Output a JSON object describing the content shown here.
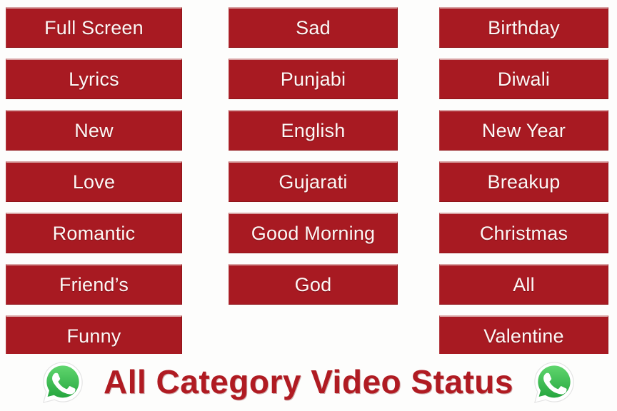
{
  "app": {
    "title": "All Category Video Status",
    "title_color": "#b01b22",
    "button_color": "#a81a22",
    "button_text_color": "#fdf7f5",
    "background_color": "#fdfdfc"
  },
  "footer": {
    "left_icon": "whatsapp-icon",
    "right_icon": "whatsapp-icon",
    "icon_color_light": "#5ed06a",
    "icon_color_dark": "#2aa84a"
  },
  "grid": {
    "columns": [
      {
        "name": "column-1",
        "buttons": [
          {
            "label": "Full Screen"
          },
          {
            "label": "Lyrics"
          },
          {
            "label": "New"
          },
          {
            "label": "Love"
          },
          {
            "label": "Romantic"
          },
          {
            "label": "Friend’s"
          },
          {
            "label": "Funny"
          }
        ]
      },
      {
        "name": "column-2",
        "buttons": [
          {
            "label": "Sad"
          },
          {
            "label": "Punjabi"
          },
          {
            "label": "English"
          },
          {
            "label": "Gujarati"
          },
          {
            "label": "Good Morning"
          },
          {
            "label": "God"
          },
          {
            "label": ""
          }
        ]
      },
      {
        "name": "column-3",
        "buttons": [
          {
            "label": "Birthday"
          },
          {
            "label": "Diwali"
          },
          {
            "label": "New Year"
          },
          {
            "label": "Breakup"
          },
          {
            "label": "Christmas"
          },
          {
            "label": "All"
          },
          {
            "label": "Valentine"
          }
        ]
      }
    ]
  }
}
